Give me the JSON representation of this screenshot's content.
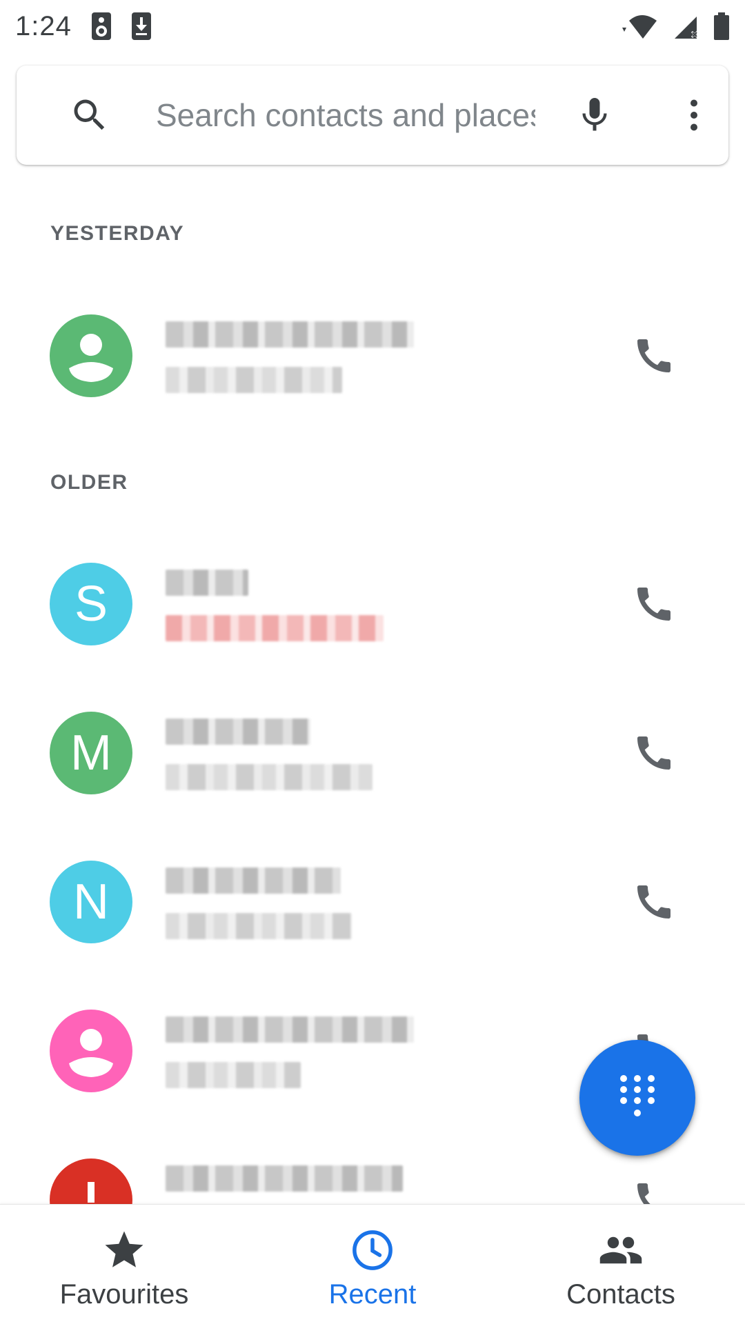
{
  "status_bar": {
    "time": "1:24",
    "icons": [
      "speaker-icon",
      "download-icon",
      "wifi-icon",
      "cell-signal-icon",
      "battery-icon"
    ]
  },
  "search": {
    "placeholder": "Search contacts and places"
  },
  "sections": {
    "yesterday": "YESTERDAY",
    "older": "OLDER"
  },
  "calls": [
    {
      "avatar_type": "person",
      "avatar_letter": "",
      "avatar_color": "#5bb974",
      "missed": false
    },
    {
      "avatar_type": "letter",
      "avatar_letter": "S",
      "avatar_color": "#4ecde6",
      "missed": true
    },
    {
      "avatar_type": "letter",
      "avatar_letter": "M",
      "avatar_color": "#5bb974",
      "missed": false
    },
    {
      "avatar_type": "letter",
      "avatar_letter": "N",
      "avatar_color": "#4ecde6",
      "missed": false
    },
    {
      "avatar_type": "person",
      "avatar_letter": "",
      "avatar_color": "#ff63b8",
      "missed": false
    },
    {
      "avatar_type": "spam",
      "avatar_letter": "",
      "avatar_color": "#d93025",
      "missed": false
    }
  ],
  "bottom_nav": {
    "favourites": "Favourites",
    "recent": "Recent",
    "contacts": "Contacts",
    "active": "recent"
  },
  "colors": {
    "accent": "#1a73e8",
    "icon_gray": "#5f6368",
    "missed_red": "#d93025"
  }
}
